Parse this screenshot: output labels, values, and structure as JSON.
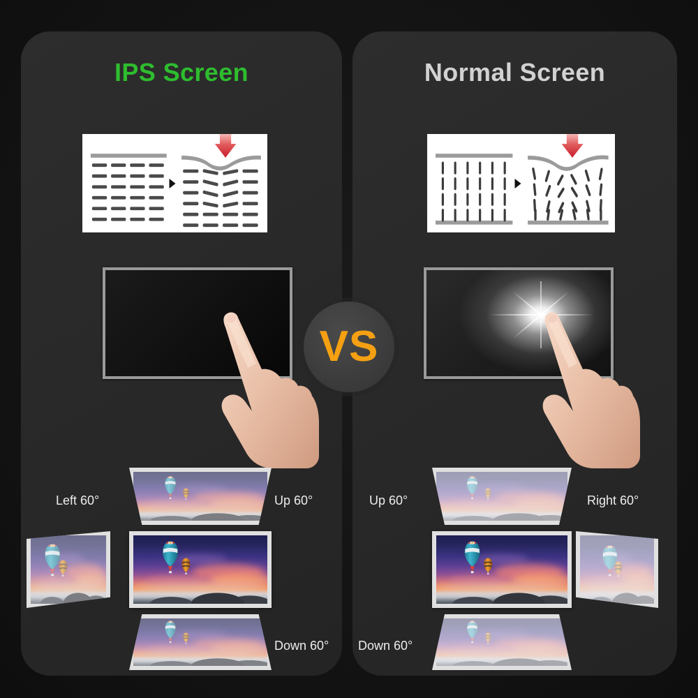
{
  "page": {
    "background_color": "#131313",
    "panel_color": "#2a2a2a"
  },
  "comparison": {
    "vs_badge": {
      "label": "VS",
      "text_color": "#f5a012",
      "circle_color": "#3c3c3c"
    },
    "left_panel": {
      "title": "IPS Screen",
      "title_color": "#2ebd2e",
      "crystal_diagram": {
        "alt": "IPS in-plane liquid crystal alignment, unpressed then pressed with no distortion",
        "state_before": "horizontal aligned crystals",
        "state_after": "horizontal crystals bend slightly under pressure",
        "arrow_icon": "press-arrow-down",
        "separator_icon": "triangle-right-icon"
      },
      "monitor": {
        "alt": "Finger pressing IPS screen, display stays black with no glow",
        "screen_state": "no pressure mark"
      },
      "viewing_angles": {
        "up": "Up 60°",
        "down": "Down 60°",
        "side": "Left 60°",
        "center_alt": "Hot air balloons at sunset, full color from center"
      }
    },
    "right_panel": {
      "title": "Normal Screen",
      "title_color": "#d2d2d2",
      "crystal_diagram": {
        "alt": "Normal TN panel vertical liquid crystals scatter when pressed",
        "state_before": "vertical aligned crystals",
        "state_after": "vertical crystals scatter chaotically under pressure",
        "arrow_icon": "press-arrow-down",
        "separator_icon": "triangle-right-icon"
      },
      "monitor": {
        "alt": "Finger pressing normal screen, bright white pressure glow appears",
        "screen_state": "bright pressure flare"
      },
      "viewing_angles": {
        "up": "Up 60°",
        "down": "Down 60°",
        "side": "Right 60°",
        "center_alt": "Hot air balloons at sunset, washed out at angle"
      }
    }
  }
}
